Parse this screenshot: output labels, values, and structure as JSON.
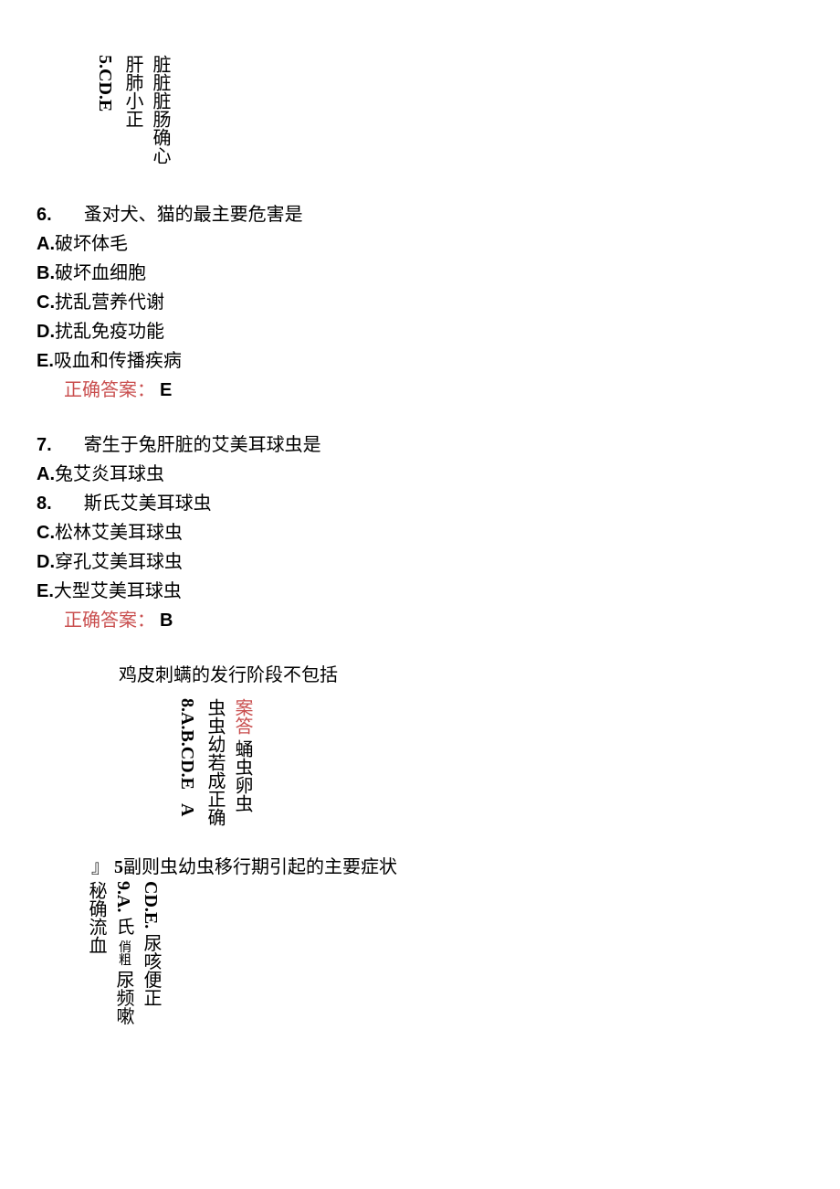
{
  "block1": {
    "vertical_text": "脏脏脏肠确心肝肺小正",
    "label_text": "5.CD.E"
  },
  "q6": {
    "number": "6.",
    "text": "蚤对犬、猫的最主要危害是",
    "options": {
      "A": "破坏体毛",
      "B": "破坏血细胞",
      "C": "扰乱营养代谢",
      "D": "扰乱免疫功能",
      "E": "吸血和传播疾病"
    },
    "answer_label": "正确答案：",
    "answer": "E"
  },
  "q7": {
    "number": "7.",
    "text": "寄生于兔肝脏的艾美耳球虫是",
    "options": {
      "A": "兔艾炎耳球虫"
    },
    "line8_number": "8.",
    "line8_text": "斯氏艾美耳球虫",
    "options_rest": {
      "C": "松林艾美耳球虫",
      "D": "穿孔艾美耳球虫",
      "E": "大型艾美耳球虫"
    },
    "answer_label": "正确答案：",
    "answer": "B"
  },
  "q8": {
    "text": "鸡皮刺螨的发行阶段不包括",
    "vertical_answer_red": "案答",
    "vertical_text": "蛹虫卵虫虫虫幼若成正确",
    "vertical_labels": "8.A.B.CD.E",
    "answer_letter": "A"
  },
  "q9": {
    "symbol": "』",
    "number": "5",
    "text": "副则虫幼虫移行期引起的主要症状",
    "vertical_labels": "CD.E.",
    "vertical_text1": "尿咳便正",
    "vertical_num": "9.A.",
    "vertical_text2": "氏",
    "vertical_text3": "尿频嗽秘确流血",
    "small_text": "俏粗"
  }
}
